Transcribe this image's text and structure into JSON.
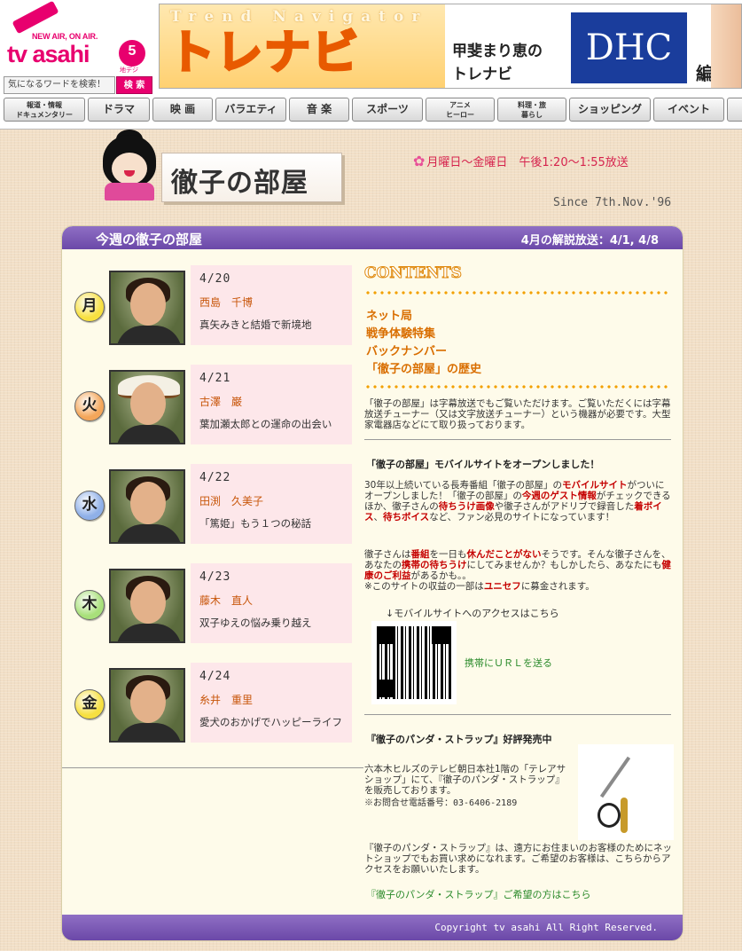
{
  "header": {
    "logo_tagline": "NEW AIR, ON AIR.",
    "logo_name": "tv asahi",
    "logo_channel": "5",
    "logo_channel_sub": "地デジ",
    "search_placeholder": "気になるワードを検索！",
    "search_button": "検 索",
    "banner": {
      "tagline": "Trend Navigator",
      "title": "トレナビ",
      "caption": "甲斐まり恵の\nトレナビ",
      "sponsor": "DHC",
      "extra": "編"
    },
    "nav": [
      "報道・情報\nドキュメンタリー",
      "ドラマ",
      "映 画",
      "バラエティ",
      "音 楽",
      "スポーツ",
      "アニメ\nヒーロー",
      "料理・旅\n暮らし",
      "ショッピング",
      "イベント"
    ]
  },
  "program": {
    "title": "徹子の部屋",
    "schedule": "月曜日～金曜日　午後1:20～1:55放送",
    "since": "Since 7th.Nov.'96"
  },
  "panel": {
    "bar_left": "今週の徹子の部屋",
    "bar_right": "4月の解説放送：4/1, 4/8",
    "footer": "Copyright tv asahi All Right Reserved."
  },
  "week": [
    {
      "day": "月",
      "color": "#f7e040",
      "date": "4/20",
      "guest": "西島　千博",
      "topic": "真矢みきと結婚で新境地"
    },
    {
      "day": "火",
      "color": "#f4a65a",
      "date": "4/21",
      "guest": "古澤　巌",
      "topic": "葉加瀬太郎との運命の出会い"
    },
    {
      "day": "水",
      "color": "#8fb0e8",
      "date": "4/22",
      "guest": "田渕　久美子",
      "topic": "「篤姫」もう１つの秘話"
    },
    {
      "day": "木",
      "color": "#a8e07a",
      "date": "4/23",
      "guest": "藤木　直人",
      "topic": "双子ゆえの悩み乗り越え"
    },
    {
      "day": "金",
      "color": "#f7e040",
      "date": "4/24",
      "guest": "糸井　重里",
      "topic": "愛犬のおかげでハッピーライフ"
    }
  ],
  "contents": {
    "heading": "CONTENTS",
    "links": [
      "ネット局",
      "戦争体験特集",
      "バックナンバー",
      "「徹子の部屋」の歴史"
    ]
  },
  "caption_text": "「徹子の部屋」は字幕放送でもご覧いただけます。ご覧いただくには字幕放送チューナー（又は文字放送チューナー）という機器が必要です。大型家電器店などにて取り扱っております。",
  "mobile": {
    "heading": "「徹子の部屋」モバイルサイトをオープンしました！",
    "p1_a": "30年以上続いている長寿番組「徹子の部屋」の",
    "p1_b": "モバイルサイト",
    "p1_c": "がついにオープンしました！「徹子の部屋」の",
    "p1_d": "今週のゲスト情報",
    "p1_e": "がチェックできるほか、徹子さんの",
    "p1_f": "待ちうけ画像",
    "p1_g": "や徹子さんがアドリブで録音した",
    "p1_h": "着ボイス",
    "p1_i": "、",
    "p1_j": "待ちボイス",
    "p1_k": "など、ファン必見のサイトになっています！",
    "p2_a": "徹子さんは",
    "p2_b": "番組",
    "p2_c": "を一日も",
    "p2_d": "休んだことがない",
    "p2_e": "そうです。そんな徹子さんを、あなたの",
    "p2_f": "携帯の待ちうけ",
    "p2_g": "にしてみませんか？もしかしたら、あなたにも",
    "p2_h": "健康のご利益",
    "p2_i": "があるかも。。",
    "p3_a": "※このサイトの収益の一部は",
    "p3_b": "ユニセフ",
    "p3_c": "に募金されます。",
    "qr_caption": "↓モバイルサイトへのアクセスはこちら",
    "send_url": "携帯にＵＲＬを送る"
  },
  "strap": {
    "heading": "『徹子のパンダ・ストラップ』好評発売中",
    "text1": "六本木ヒルズのテレビ朝日本社1階の「テレアサショップ」にて、『徹子のパンダ・ストラップ』を販売しております。",
    "phone": "※お問合せ電話番号：03-6406-2189",
    "text2": "『徹子のパンダ・ストラップ』は、遠方にお住まいのお客様のためにネットショップでもお買い求めになれます。ご希望のお客様は、こちらからアクセスをお願いいたします。",
    "link": "『徹子のパンダ・ストラップ』ご希望の方はこちら"
  }
}
